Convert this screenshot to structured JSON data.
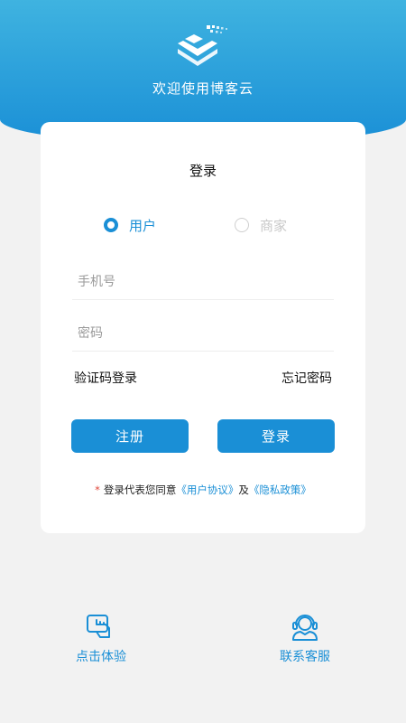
{
  "header": {
    "welcome": "欢迎使用博客云",
    "logo_icon": "cube-logo-icon"
  },
  "login_card": {
    "title": "登录",
    "roles": [
      {
        "label": "用户",
        "selected": true
      },
      {
        "label": "商家",
        "selected": false
      }
    ],
    "phone_placeholder": "手机号",
    "password_placeholder": "密码",
    "sms_login_label": "验证码登录",
    "forgot_password_label": "忘记密码",
    "register_label": "注册",
    "login_label": "登录",
    "agreement": {
      "star": "*",
      "prefix": "登录代表您同意",
      "user_agreement": "《用户协议》",
      "and": "及",
      "privacy_policy": "《隐私政策》"
    }
  },
  "bottom": {
    "trial": {
      "label": "点击体验",
      "icon": "tap-hand-icon"
    },
    "service": {
      "label": "联系客服",
      "icon": "headset-icon"
    }
  },
  "colors": {
    "accent": "#1a8fd6",
    "header_top": "#3fb3e0",
    "background": "#f2f2f2",
    "inactive": "#c8c8c8"
  }
}
